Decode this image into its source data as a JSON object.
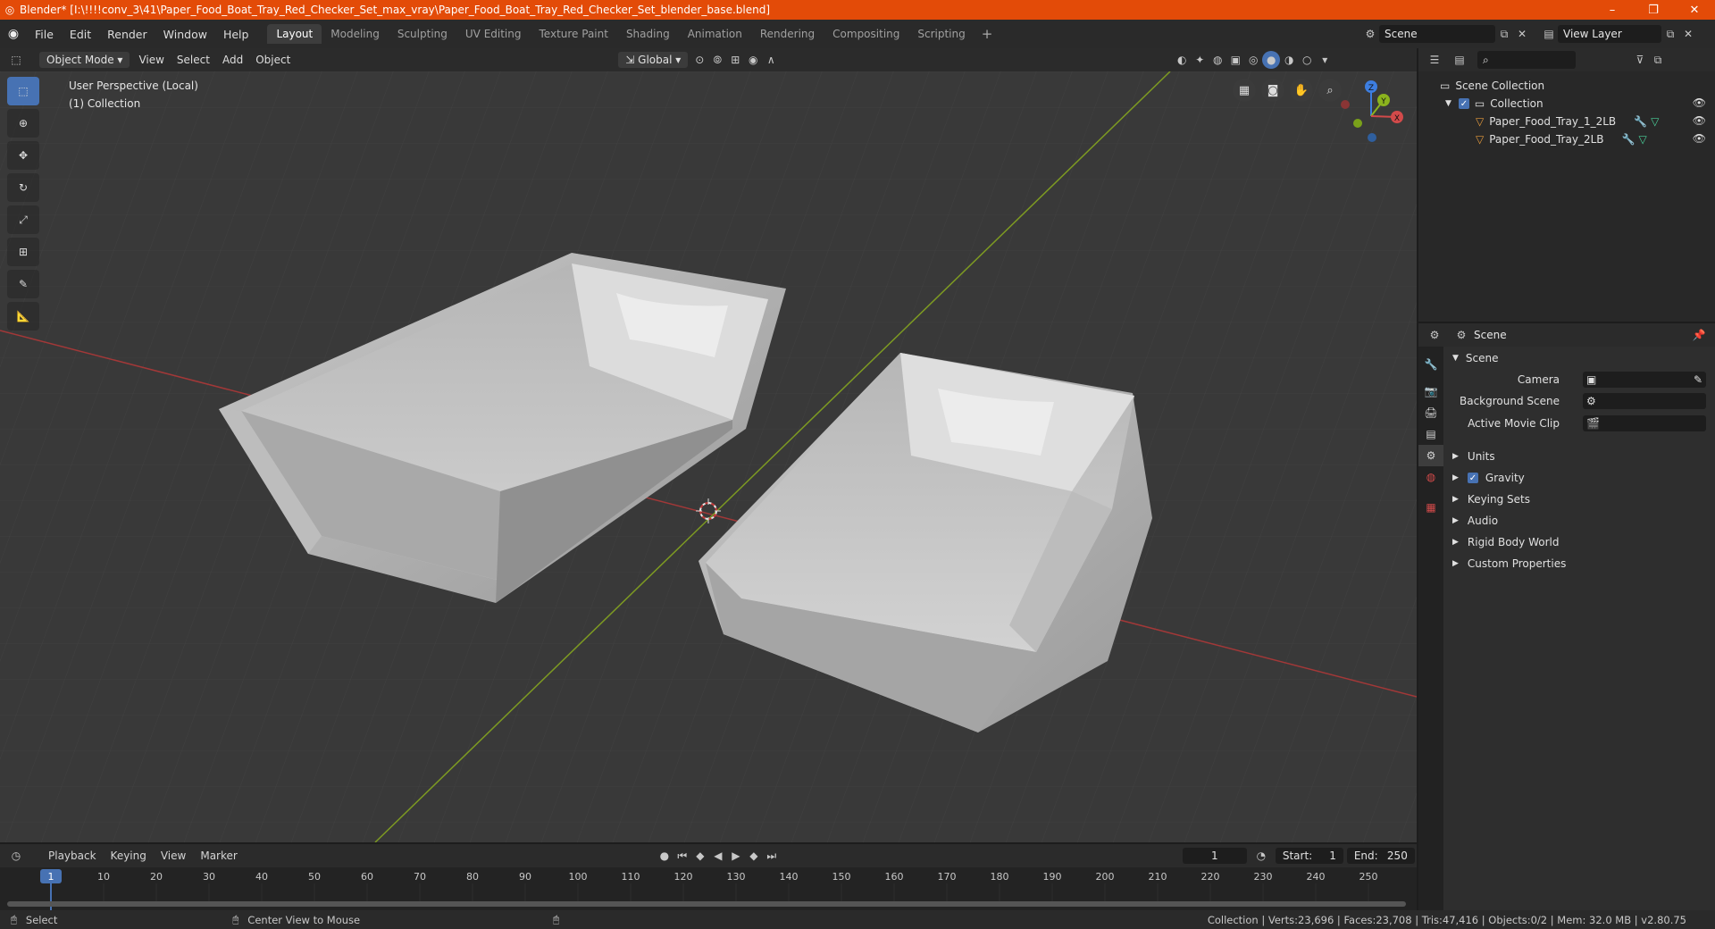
{
  "window": {
    "title": "Blender* [I:\\!!!!conv_3\\41\\Paper_Food_Boat_Tray_Red_Checker_Set_max_vray\\Paper_Food_Boat_Tray_Red_Checker_Set_blender_base.blend]",
    "minimize": "–",
    "maximize": "❐",
    "close": "✕"
  },
  "menu": [
    "File",
    "Edit",
    "Render",
    "Window",
    "Help"
  ],
  "workspaces": [
    "Layout",
    "Modeling",
    "Sculpting",
    "UV Editing",
    "Texture Paint",
    "Shading",
    "Animation",
    "Rendering",
    "Compositing",
    "Scripting"
  ],
  "workspace_add": "+",
  "scene_selector": {
    "value": "Scene"
  },
  "view_layer": {
    "value": "View Layer"
  },
  "viewport_header": {
    "mode": "Object Mode",
    "menus": [
      "View",
      "Select",
      "Add",
      "Object"
    ],
    "orientation": "Global"
  },
  "viewport": {
    "perspective": "User Perspective (Local)",
    "collection": "(1) Collection"
  },
  "gizmo": {
    "x": "X",
    "y": "Y",
    "z": "Z"
  },
  "timeline": {
    "menus": [
      "Playback",
      "Keying",
      "View",
      "Marker"
    ],
    "current_frame": "1",
    "start_label": "Start:",
    "start": "1",
    "end_label": "End:",
    "end": "250",
    "ticks": [
      "1",
      "10",
      "20",
      "30",
      "40",
      "50",
      "60",
      "70",
      "80",
      "90",
      "100",
      "110",
      "120",
      "130",
      "140",
      "150",
      "160",
      "170",
      "180",
      "190",
      "200",
      "210",
      "220",
      "230",
      "240",
      "250"
    ]
  },
  "status": {
    "select": "Select",
    "center_view": "Center View to Mouse",
    "stats": "Collection | Verts:23,696 | Faces:23,708 | Tris:47,416 | Objects:0/2 | Mem: 32.0 MB | v2.80.75"
  },
  "outliner": {
    "scene_collection": "Scene Collection",
    "collection": "Collection",
    "objects": [
      "Paper_Food_Tray_1_2LB",
      "Paper_Food_Tray_2LB"
    ]
  },
  "properties": {
    "header": "Scene",
    "panel_title": "Scene",
    "camera_label": "Camera",
    "background_scene_label": "Background Scene",
    "active_movie_clip_label": "Active Movie Clip",
    "sections": [
      "Units",
      "Gravity",
      "Keying Sets",
      "Audio",
      "Rigid Body World",
      "Custom Properties"
    ]
  },
  "colors": {
    "accent": "#4772b3",
    "titlebar": "#e34b08",
    "x_axis": "#d24a4a",
    "y_axis": "#8bb31e",
    "z_axis": "#3d7ee0"
  }
}
